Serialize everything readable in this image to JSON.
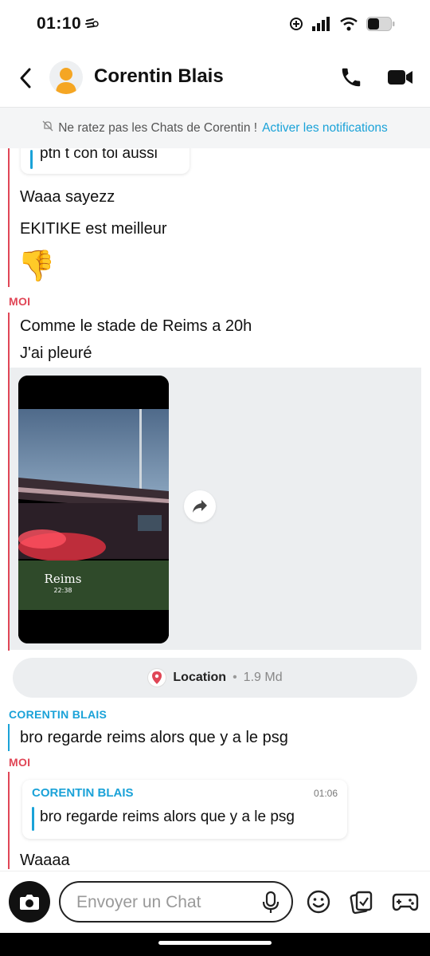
{
  "status_bar": {
    "time": "01:10"
  },
  "header": {
    "contact_name": "Corentin Blais"
  },
  "notification_banner": {
    "text": "Ne ratez pas les Chats de Corentin !",
    "link": "Activer les notifications"
  },
  "messages": {
    "quoted_top": "ptn t con toi aussi",
    "them_1": "Waaa sayezz",
    "them_2": "EKITIKE est meilleur",
    "them_emoji": "👎",
    "me_sender": "MOI",
    "me_1": "Comme le stade de Reims a 20h",
    "me_2": "J'ai pleuré",
    "snap_caption": "Reims",
    "snap_time": "22:38",
    "location_label": "Location",
    "location_distance": "1.9 Md",
    "them_sender": "CORENTIN BLAIS",
    "them_3": "bro regarde reims alors que y a le psg",
    "me_sender_2": "MOI",
    "reply_quote_sender": "CORENTIN BLAIS",
    "reply_quote_time": "01:06",
    "reply_quote_text": "bro regarde reims alors que y a le psg",
    "me_3": "Waaaa"
  },
  "input": {
    "placeholder": "Envoyer un Chat"
  },
  "colors": {
    "me": "#e04656",
    "them": "#1aa2d8"
  }
}
